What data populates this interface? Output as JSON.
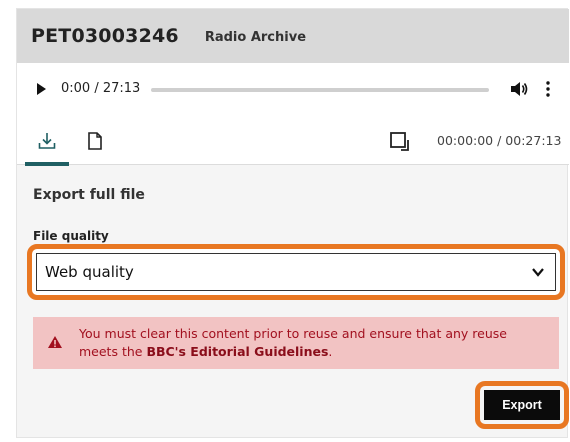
{
  "header": {
    "programme_id": "PET03003246",
    "collection": "Radio Archive"
  },
  "player": {
    "time": "0:00 / 27:13",
    "progress_fraction": 0.0
  },
  "tabs": {
    "active": "download",
    "range": "00:00:00 / 00:27:13"
  },
  "export": {
    "section_title": "Export full file",
    "quality_label": "File quality",
    "quality_value": "Web quality",
    "warning_text": "You must clear this content prior to reuse and ensure that any reuse meets the",
    "warning_link": "BBC's Editorial Guidelines",
    "warning_end": ".",
    "button_label": "Export"
  },
  "colors": {
    "highlight": "#e87722",
    "tab_indicator": "#1f5f63",
    "alert_bg": "#f2c3c3",
    "alert_text": "#a2101f"
  }
}
